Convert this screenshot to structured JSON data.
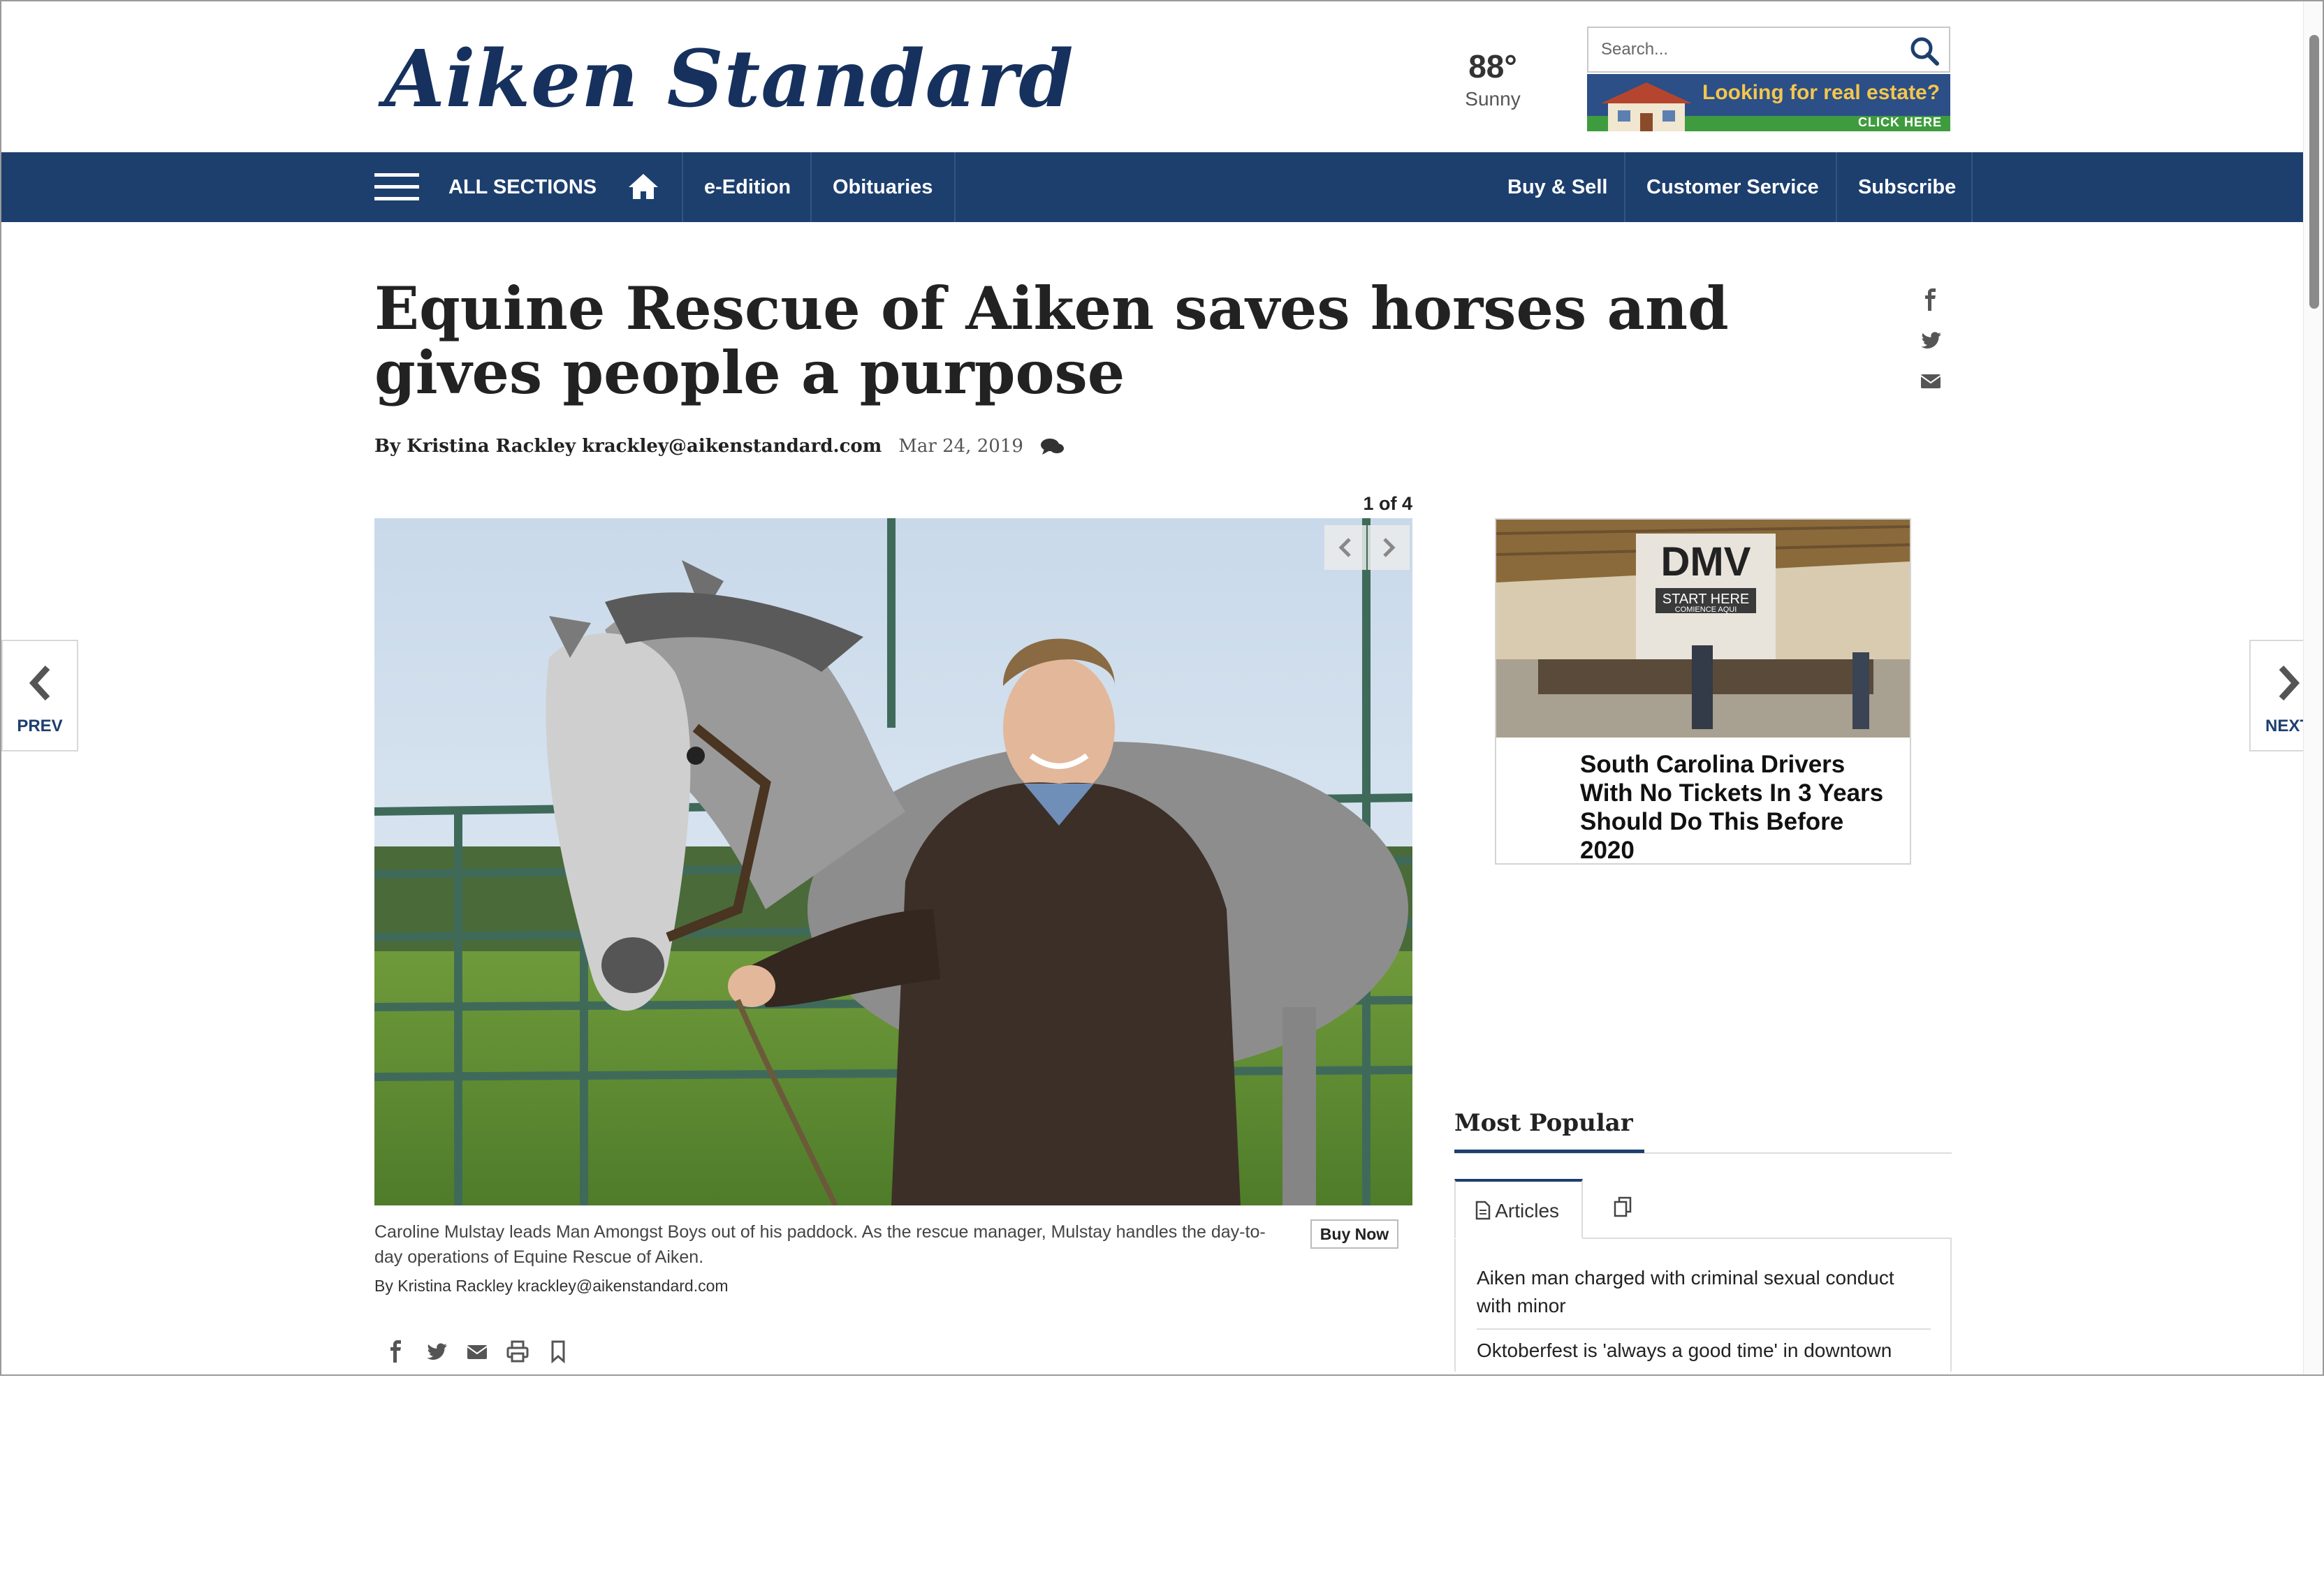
{
  "header": {
    "logo_text": "Aiken Standard",
    "weather": {
      "temp": "88°",
      "condition": "Sunny"
    },
    "search": {
      "placeholder": "Search..."
    },
    "real_estate_ad": {
      "headline": "Looking for real estate?",
      "cta": "CLICK HERE"
    }
  },
  "nav": {
    "menu_label": "ALL SECTIONS",
    "left_items": [
      "e-Edition",
      "Obituaries"
    ],
    "right_items": [
      "Buy & Sell",
      "Customer Service",
      "Subscribe"
    ],
    "background_color": "#1d3f6e"
  },
  "article": {
    "headline": "Equine Rescue of Aiken saves horses and gives people a purpose",
    "byline": "By Kristina Rackley krackley@aikenstandard.com",
    "date": "Mar 24, 2019",
    "gallery_counter": "1 of 4",
    "caption": "Caroline Mulstay leads Man Amongst Boys out of his paddock. As the rescue manager, Mulstay handles the day-to-day operations of Equine Rescue of Aiken.",
    "photo_credit": "By Kristina Rackley krackley@aikenstandard.com",
    "buy_now_label": "Buy Now"
  },
  "side_nav": {
    "prev": "PREV",
    "next": "NEXT"
  },
  "sidebar_ad": {
    "image_sign": "DMV",
    "image_subsign": "START HERE",
    "image_subsign2": "COMIENCE AQUI",
    "title": "South Carolina Drivers With No Tickets In 3 Years Should Do This Before 2020"
  },
  "most_popular": {
    "title": "Most Popular",
    "tabs": [
      "Articles"
    ],
    "items": [
      "Aiken man charged with criminal sexual conduct with minor",
      "Oktoberfest is 'always a good time' in downtown"
    ]
  }
}
